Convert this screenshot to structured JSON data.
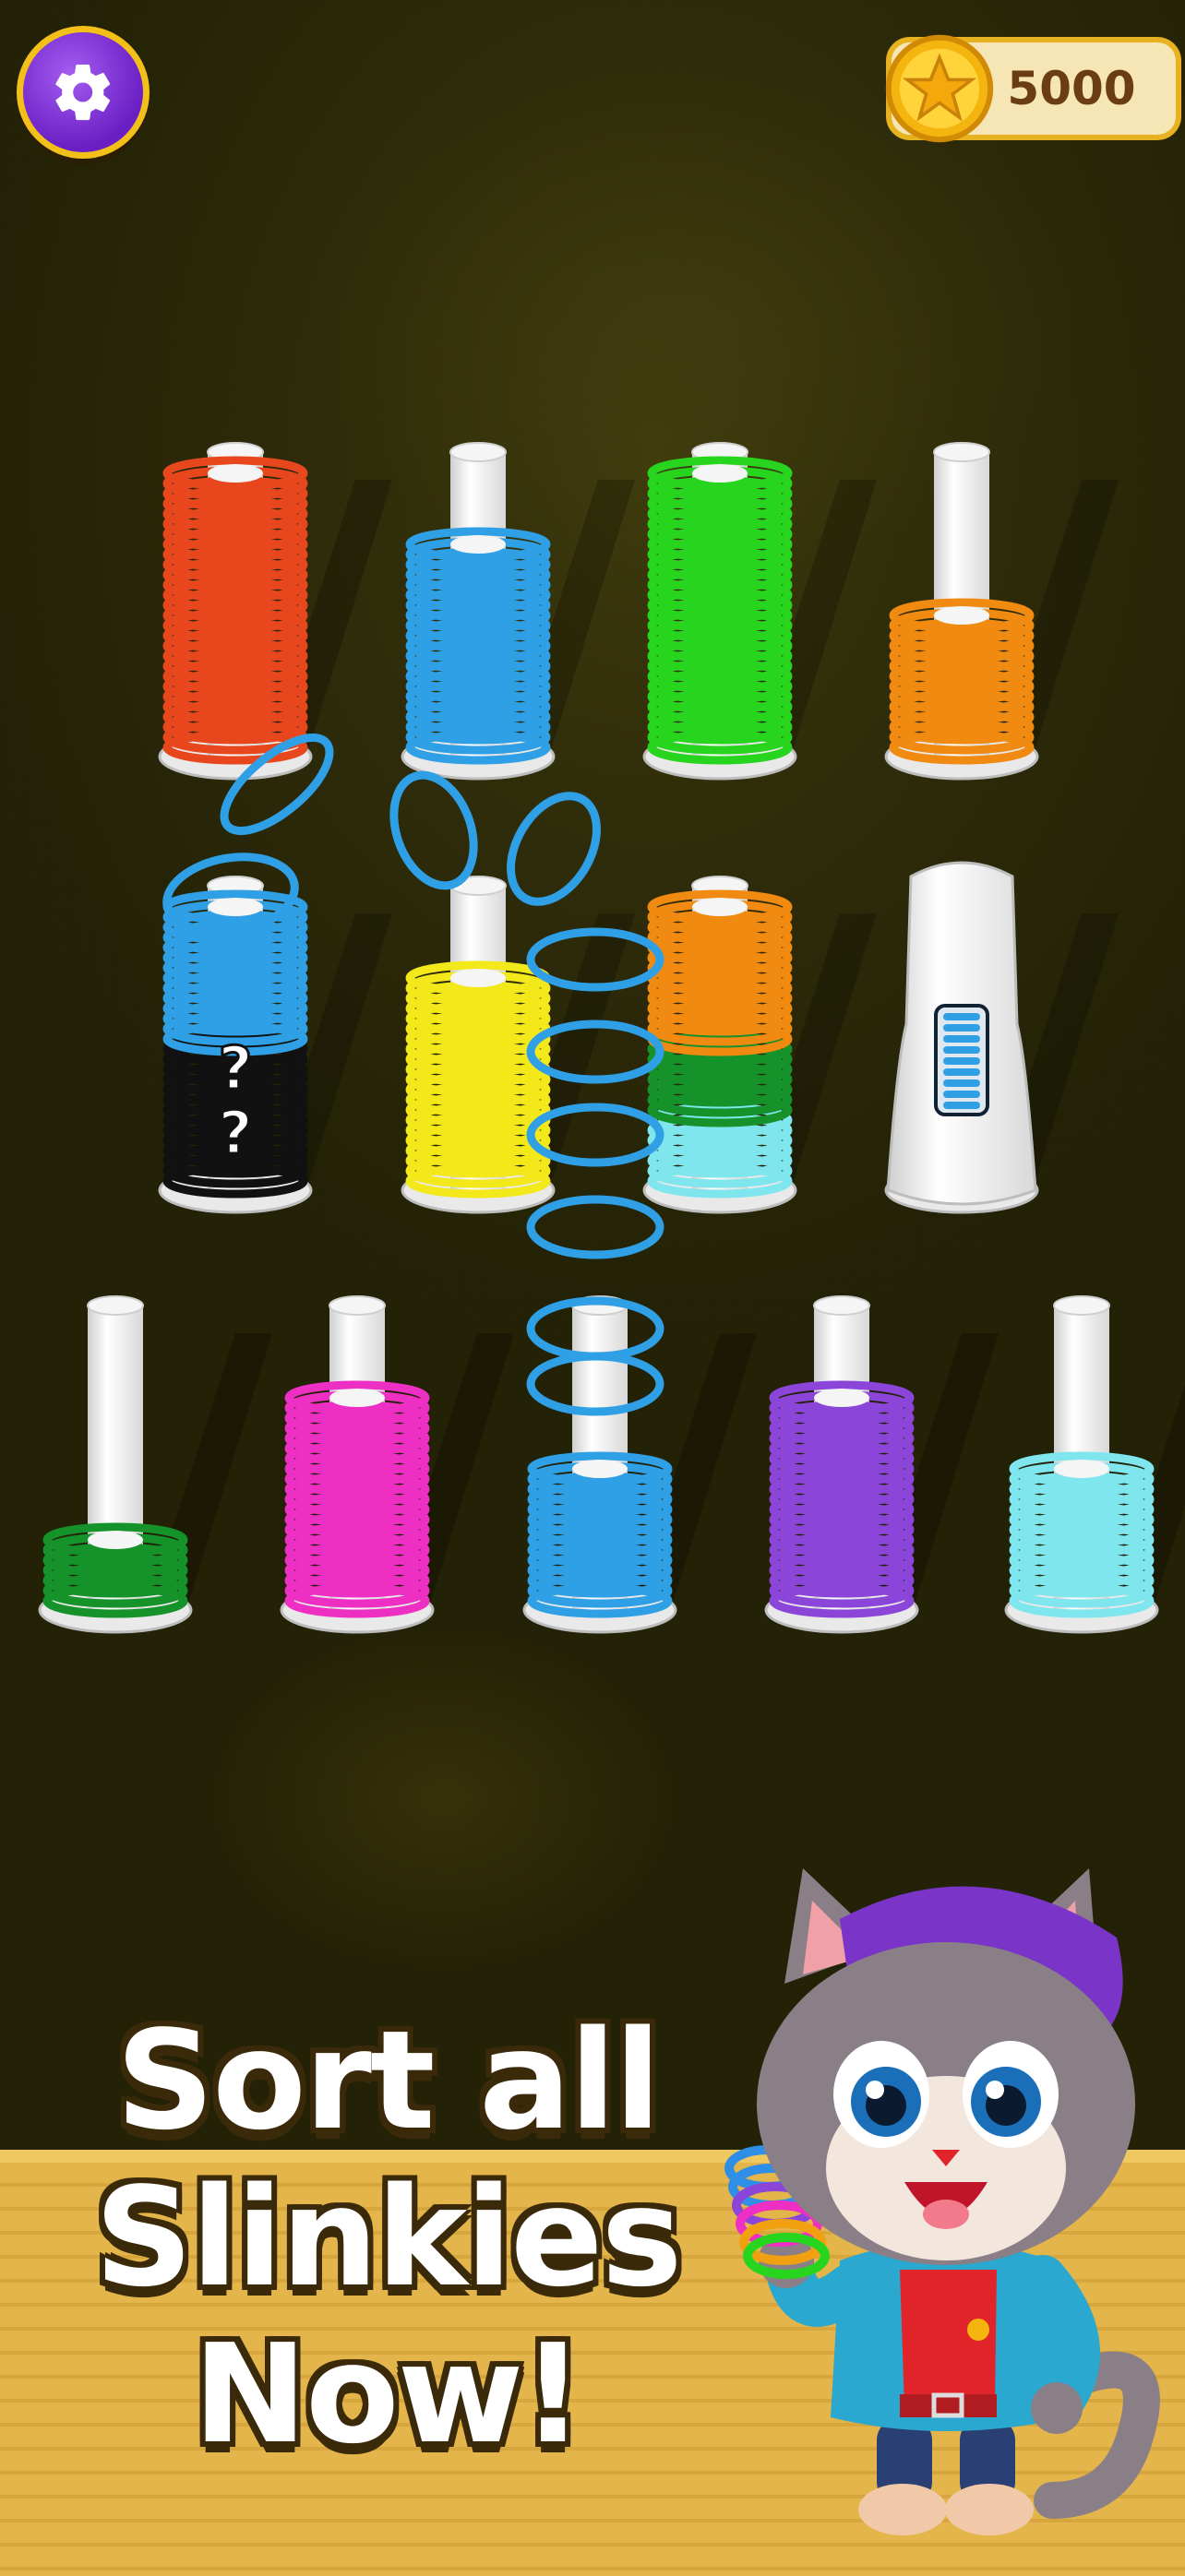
{
  "hud": {
    "coins": "5000",
    "settings_icon": "gear-icon",
    "coin_icon": "star-coin-icon"
  },
  "banner": {
    "line1": "Sort all",
    "line2": "Slinkies",
    "line3": "Now!"
  },
  "colors": {
    "red": "#e8461c",
    "blue": "#2fa0e6",
    "green": "#28d51e",
    "orange": "#f08a10",
    "yellow": "#f2e81a",
    "black": "#111111",
    "dark_green": "#15932a",
    "cyan": "#7fe6ee",
    "magenta": "#ee2fc4",
    "purple": "#8b45d9",
    "accent_purple": "#7a2fd8",
    "accent_gold": "#f2c019"
  },
  "pegs": [
    {
      "id": "peg-1",
      "stack": [
        "red",
        "red",
        "red",
        "red"
      ],
      "state": "full"
    },
    {
      "id": "peg-2",
      "stack": [
        "blue",
        "blue",
        "blue"
      ],
      "state": "partial"
    },
    {
      "id": "peg-3",
      "stack": [
        "green",
        "green",
        "green",
        "green"
      ],
      "state": "full"
    },
    {
      "id": "peg-4",
      "stack": [
        "orange",
        "orange"
      ],
      "state": "partial"
    },
    {
      "id": "peg-5",
      "stack": [
        "black",
        "black",
        "blue",
        "blue"
      ],
      "state": "hidden",
      "hidden_marks": [
        "?",
        "?"
      ]
    },
    {
      "id": "peg-6",
      "stack": [
        "yellow",
        "yellow",
        "yellow"
      ],
      "state": "partial"
    },
    {
      "id": "peg-7",
      "stack": [
        "cyan",
        "dark_green",
        "orange",
        "orange"
      ],
      "state": "full"
    },
    {
      "id": "peg-8",
      "stack": [],
      "state": "locked",
      "lock_icon": "slinky-lock-icon"
    },
    {
      "id": "peg-9",
      "stack": [
        "dark_green"
      ],
      "state": "partial"
    },
    {
      "id": "peg-10",
      "stack": [
        "magenta",
        "magenta",
        "magenta"
      ],
      "state": "partial"
    },
    {
      "id": "peg-11",
      "stack": [
        "blue",
        "blue"
      ],
      "state": "receiving"
    },
    {
      "id": "peg-12",
      "stack": [
        "purple",
        "purple",
        "purple"
      ],
      "state": "partial"
    },
    {
      "id": "peg-13",
      "stack": [
        "cyan",
        "cyan"
      ],
      "state": "partial"
    }
  ]
}
